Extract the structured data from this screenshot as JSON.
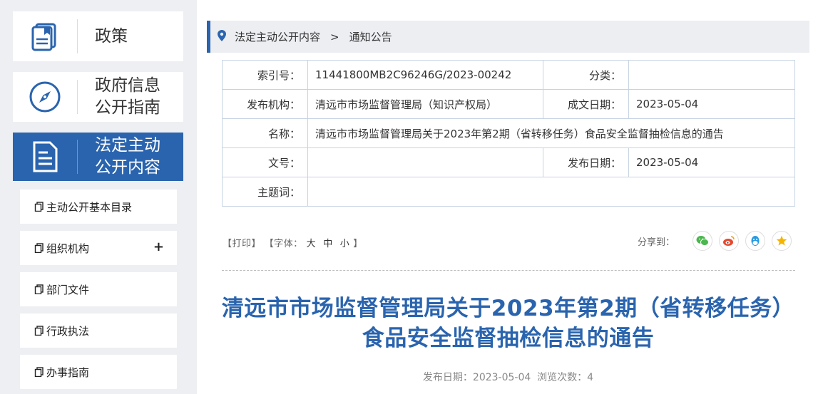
{
  "sidebar": {
    "nav": [
      {
        "label": "政策",
        "icon": "book-icon"
      },
      {
        "label": "政府信息\n公开指南",
        "icon": "compass-icon"
      },
      {
        "label": "法定主动\n公开内容",
        "icon": "document-icon"
      }
    ],
    "sub_items": [
      {
        "label": "主动公开基本目录"
      },
      {
        "label": "组织机构",
        "expand": "+"
      },
      {
        "label": "部门文件"
      },
      {
        "label": "行政执法"
      },
      {
        "label": "办事指南"
      }
    ]
  },
  "breadcrumb": {
    "items": [
      "法定主动公开内容",
      "通知公告"
    ],
    "separator": ">"
  },
  "meta": {
    "index_label": "索引号：",
    "index_value": "11441800MB2C96246G/2023-00242",
    "category_label": "分类：",
    "category_value": "",
    "issuer_label": "发布机构：",
    "issuer_value": "清远市市场监督管理局（知识产权局）",
    "created_label": "成文日期：",
    "created_value": "2023-05-04",
    "name_label": "名称：",
    "name_value": "清远市市场监督管理局关于2023年第2期（省转移任务）食品安全监督抽检信息的通告",
    "docno_label": "文号：",
    "docno_value": "",
    "published_label": "发布日期：",
    "published_value": "2023-05-04",
    "subject_label": "主题词：",
    "subject_value": ""
  },
  "tools": {
    "print": "【打印】",
    "font_prefix": "【字体：",
    "font_large": "大",
    "font_medium": "中",
    "font_small": "小",
    "font_suffix": "】",
    "share_label": "分享到："
  },
  "share_icons": [
    "wechat-icon",
    "weibo-icon",
    "qq-icon",
    "qzone-icon"
  ],
  "article": {
    "title_line1": "清远市市场监督管理局关于2023年第2期（省转移任务）",
    "title_line2": "食品安全监督抽检信息的通告",
    "pub_info": "发布日期：2023-05-04  浏览次数：4"
  },
  "colors": {
    "accent": "#2a64ae",
    "sidebar_bg": "#eeeff3",
    "wechat": "#4cb64f",
    "weibo": "#e6492f",
    "qq": "#2b9ae0",
    "qzone": "#f4b400"
  }
}
